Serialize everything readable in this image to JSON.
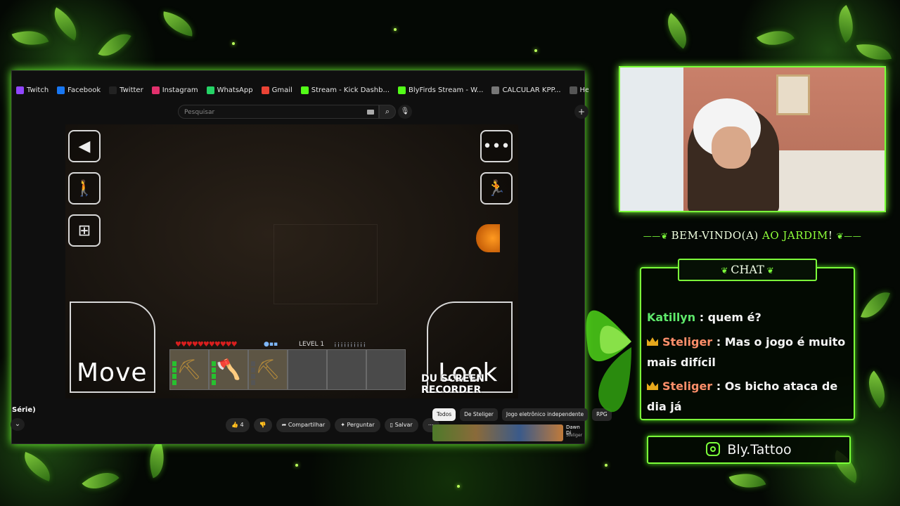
{
  "bookmarks": [
    {
      "label": "Twitch",
      "color": "#9146ff",
      "icon": "twitch-icon"
    },
    {
      "label": "Facebook",
      "color": "#1877f2",
      "icon": "facebook-icon"
    },
    {
      "label": "Twitter",
      "color": "#222222",
      "icon": "x-icon"
    },
    {
      "label": "Instagram",
      "color": "#e1306c",
      "icon": "instagram-icon"
    },
    {
      "label": "WhatsApp",
      "color": "#25d366",
      "icon": "whatsapp-icon"
    },
    {
      "label": "Gmail",
      "color": "#ea4335",
      "icon": "gmail-icon"
    },
    {
      "label": "Stream - Kick Dashb...",
      "color": "#53fc18",
      "icon": "kick-icon"
    },
    {
      "label": "BlyFirds Stream - W...",
      "color": "#53fc18",
      "icon": "kick-icon"
    },
    {
      "label": "CALCULAR KPP...",
      "color": "#777777",
      "icon": "globe-icon"
    },
    {
      "label": "Hero Siege Helper",
      "color": "#555555",
      "icon": "globe-icon"
    }
  ],
  "search": {
    "placeholder": "Pesquisar"
  },
  "game": {
    "move_label": "Move",
    "look_label": "Look",
    "level_label": "LEVEL 1",
    "recorder_watermark": "DU SCREEN RECORDER",
    "hearts": "♥♥♥♥♥♥♥♥♥♥♥",
    "ammo": "¡¡¡¡¡¡¡¡¡¡"
  },
  "video": {
    "title_fragment": "Série)",
    "like_count": "4",
    "share_label": "Compartilhar",
    "ask_label": "Perguntar",
    "save_label": "Salvar"
  },
  "chips": [
    "Todos",
    "De Steliger",
    "Jogo eletrônico independente",
    "RPG"
  ],
  "related": {
    "title": "Dawn Di",
    "channel": "Steliger"
  },
  "overlay": {
    "welcome_prefix": "BEM-VINDO(A)",
    "welcome_highlight": "AO JARDIM",
    "welcome_suffix": "!",
    "chat_title": "CHAT",
    "social_handle": "Bly.Tattoo",
    "accent_color": "#7cff3a"
  },
  "chat_messages": [
    {
      "user": "Katillyn",
      "text": "quem é?",
      "badge": false
    },
    {
      "user": "Steliger",
      "text": "Mas o jogo é muito mais difícil",
      "badge": true
    },
    {
      "user": "Steliger",
      "text": "Os bicho ataca de dia já",
      "badge": true
    }
  ]
}
